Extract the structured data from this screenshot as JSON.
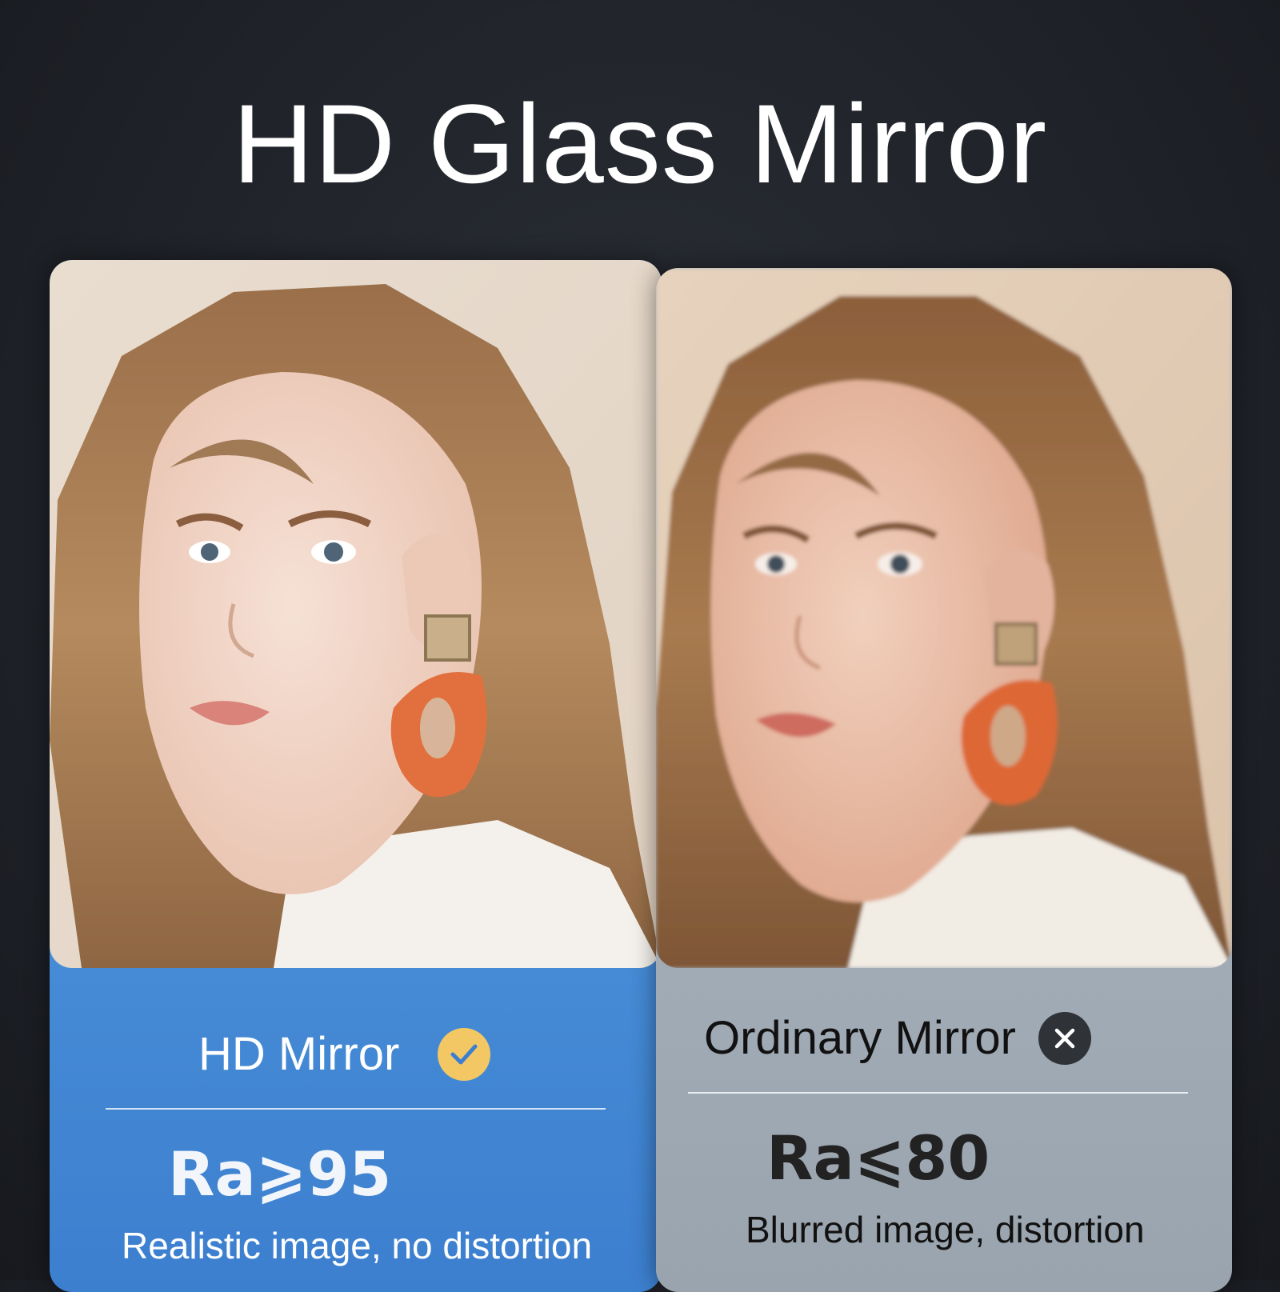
{
  "title": "HD Glass Mirror",
  "left_card": {
    "label": "HD Mirror",
    "badge_icon": "check-icon",
    "badge_color": "#f3c864",
    "rating": "Ra⩾95",
    "description": "Realistic image, no distortion",
    "panel_color": "#4a8fd8"
  },
  "right_card": {
    "label": "Ordinary Mirror",
    "badge_icon": "close-icon",
    "badge_color": "#2f3236",
    "rating": "Ra⩽80",
    "description": "Blurred image, distortion",
    "panel_color": "#a7b1bb"
  }
}
